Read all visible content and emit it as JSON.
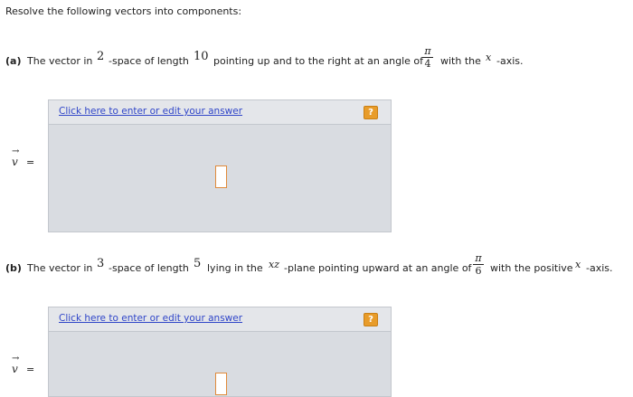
{
  "instruction": "Resolve the following vectors into components:",
  "part_a": {
    "label": "(a)",
    "t1": "The vector in",
    "dim": "2",
    "t2": "-space of length",
    "length": "10",
    "t3": "pointing up and to the right at an angle of",
    "angle_num": "π",
    "angle_den": "4",
    "t4": "with the",
    "axis": "x",
    "t5": "-axis."
  },
  "part_b": {
    "label": "(b)",
    "t1": "The vector in",
    "dim": "3",
    "t2": "-space of length",
    "length": "5",
    "t3": "lying in the",
    "plane": "xz",
    "t4": "-plane pointing upward at an angle of",
    "angle_num": "π",
    "angle_den": "6",
    "t5": "with the positive",
    "axis": "x",
    "t6": "-axis."
  },
  "answer_box": {
    "link_text": "Click here to enter or edit your answer",
    "help_label": "?"
  },
  "vector": {
    "symbol": "v",
    "arrow": "→",
    "equals": "="
  },
  "colors": {
    "link": "#2f45c8",
    "help_button": "#e89c2a",
    "box_bg": "#d9dce1",
    "input_border": "#e08a3a"
  }
}
